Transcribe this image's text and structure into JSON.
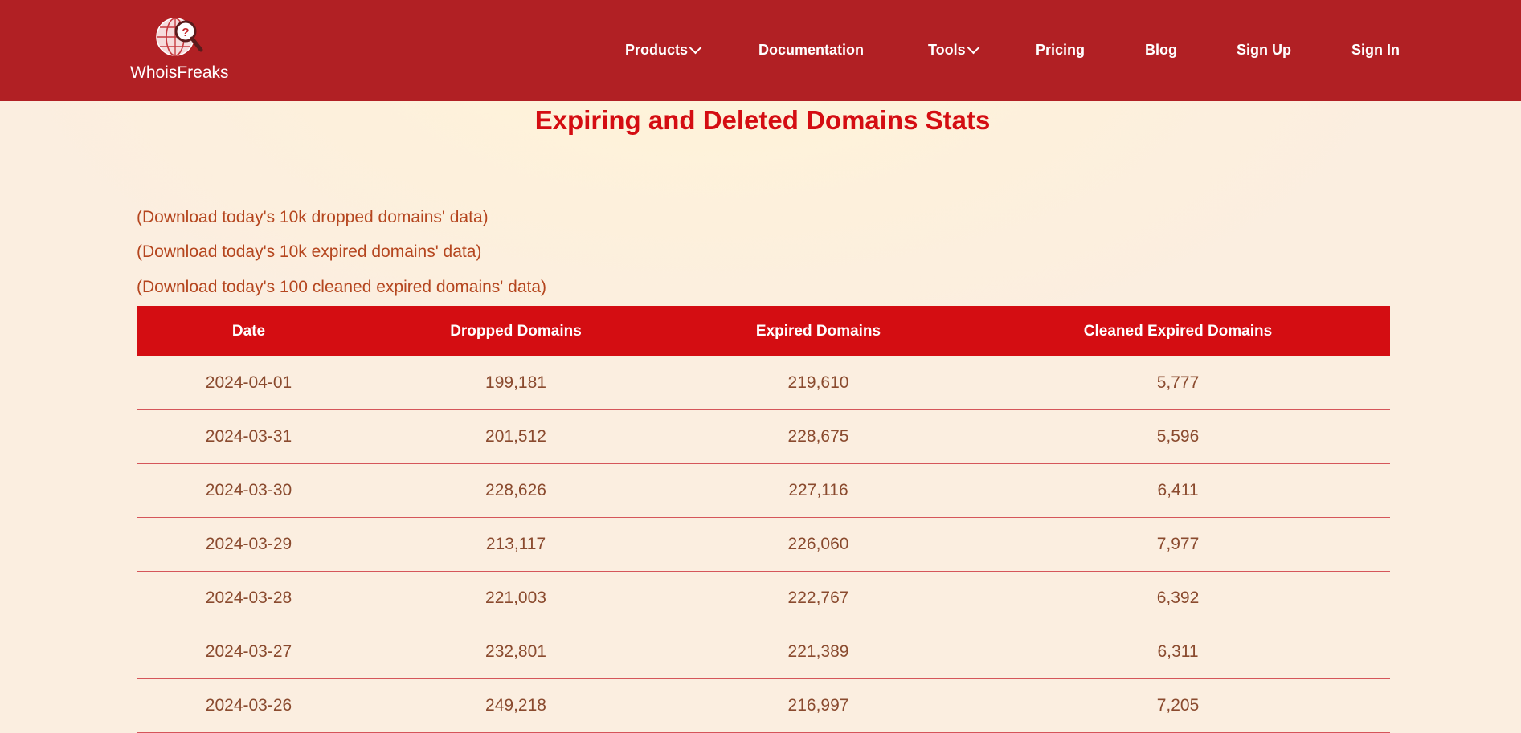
{
  "nav": {
    "logo_text": "WhoisFreaks",
    "items": [
      {
        "label": "Products",
        "has_dropdown": true
      },
      {
        "label": "Documentation",
        "has_dropdown": false
      },
      {
        "label": "Tools",
        "has_dropdown": true
      },
      {
        "label": "Pricing",
        "has_dropdown": false
      },
      {
        "label": "Blog",
        "has_dropdown": false
      },
      {
        "label": "Sign Up",
        "has_dropdown": false
      },
      {
        "label": "Sign In",
        "has_dropdown": false
      }
    ]
  },
  "page": {
    "title": "Expiring and Deleted Domains Stats"
  },
  "downloads": [
    "(Download today's 10k dropped domains' data)",
    "(Download today's 10k expired domains' data)",
    "(Download today's 100 cleaned expired domains' data)"
  ],
  "table": {
    "headers": [
      "Date",
      "Dropped Domains",
      "Expired Domains",
      "Cleaned Expired Domains"
    ],
    "rows": [
      [
        "2024-04-01",
        "199,181",
        "219,610",
        "5,777"
      ],
      [
        "2024-03-31",
        "201,512",
        "228,675",
        "5,596"
      ],
      [
        "2024-03-30",
        "228,626",
        "227,116",
        "6,411"
      ],
      [
        "2024-03-29",
        "213,117",
        "226,060",
        "7,977"
      ],
      [
        "2024-03-28",
        "221,003",
        "222,767",
        "6,392"
      ],
      [
        "2024-03-27",
        "232,801",
        "221,389",
        "6,311"
      ],
      [
        "2024-03-26",
        "249,218",
        "216,997",
        "7,205"
      ]
    ]
  },
  "colors": {
    "nav_bg": "#b12024",
    "title": "#d40d12",
    "table_header_bg": "#d40d12",
    "link": "#b5461f",
    "body_text": "#8a4a2e",
    "row_divider": "#d5555a",
    "page_bg": "#fdf0dc"
  },
  "icons": {
    "logo": "globe-magnifier-icon",
    "dropdown": "chevron-down-icon"
  }
}
